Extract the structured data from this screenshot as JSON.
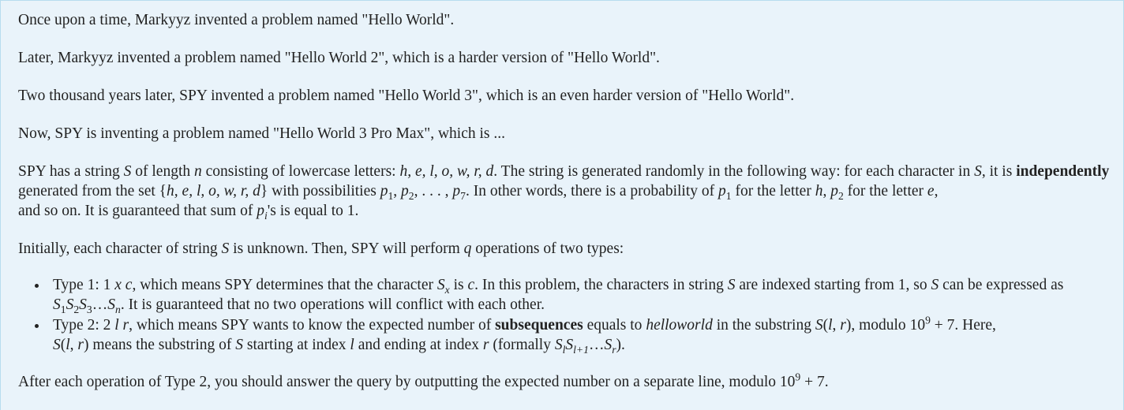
{
  "p1": "Once upon a time, Markyyz invented a problem named \"Hello World\".",
  "p2": "Later, Markyyz invented a problem named \"Hello World 2\", which is a harder version of \"Hello World\".",
  "p3": "Two thousand years later, SPY invented a problem named \"Hello World 3\", which is an even harder version of \"Hello World\".",
  "p4": "Now, SPY is inventing a problem named \"Hello World 3 Pro Max\", which is ...",
  "p5": {
    "t1": "SPY has a string ",
    "S": "S",
    "t2": " of length ",
    "n": "n",
    "t3": " consisting of lowercase letters: ",
    "letters": "h, e, l, o, w, r, d",
    "t4": ". The string is generated randomly in the following way: for each character in ",
    "t5": ", it is ",
    "bold": "independently",
    "t6": " generated from the set ",
    "set_open": "{",
    "set_close": "}",
    "t7": " with possibilities ",
    "probs_seq": "p1, p2, . . . , p7",
    "t8": ". In other words, there is a probability of ",
    "t9": " for the letter ",
    "h": "h",
    "comma": ", ",
    "e": "e",
    "t10": "and so on. It is guaranteed that sum of ",
    "pi": "p",
    "i": "i",
    "t11": "'s is equal to 1."
  },
  "p6": {
    "t1": "Initially, each character of string ",
    "S": "S",
    "t2": " is unknown. Then, SPY will perform ",
    "q": "q",
    "t3": " operations of two types:"
  },
  "list": {
    "item1": {
      "t1": "Type 1: 1 ",
      "x": "x",
      "c": "c",
      "t2": ", which means SPY determines that the character ",
      "t3": " is ",
      "t4": ". In this problem, the characters in string ",
      "t5": " are indexed starting from 1, so ",
      "t6": " can be expressed as ",
      "dots": "…",
      "n": "n",
      "t7": ". It is guaranteed that no two operations will conflict with each other."
    },
    "item2": {
      "t1": "Type 2: 2 ",
      "l": "l",
      "r": "r",
      "t2": ", which means SPY wants to know the expected number of ",
      "bold": "subsequences",
      "t3": " equals to ",
      "word": "helloworld",
      "t4": " in the substring ",
      "t5": ", modulo ",
      "ten": "10",
      "nine": "9",
      "plus7": " + 7",
      "t6": ". Here, ",
      "t7": " means the substring of ",
      "t8": " starting at index ",
      "t9": " and ending at index ",
      "t10": " (formally ",
      "lp1": "l+1",
      "t11": ")."
    }
  },
  "p7": {
    "t1": "After each operation of Type 2, you should answer the query by outputting the expected number on a separate line, modulo ",
    "ten": "10",
    "nine": "9",
    "plus7": " + 7",
    "t2": "."
  }
}
